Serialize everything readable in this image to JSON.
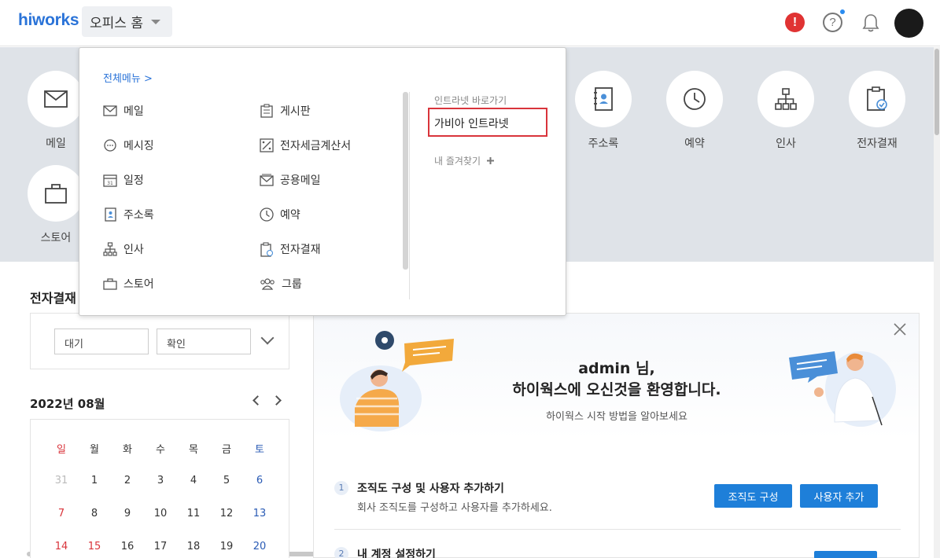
{
  "header": {
    "logo": "hiworks",
    "office_home": "오피스 홈",
    "alert_symbol": "!",
    "help_symbol": "?"
  },
  "apps": [
    {
      "label": "메일",
      "icon": "mail-icon"
    },
    {
      "label": "주소록",
      "icon": "contacts-icon"
    },
    {
      "label": "예약",
      "icon": "clock-icon"
    },
    {
      "label": "인사",
      "icon": "org-icon"
    },
    {
      "label": "전자결재",
      "icon": "approval-icon"
    },
    {
      "label": "스토어",
      "icon": "store-icon"
    }
  ],
  "menu": {
    "all_menu": "전체메뉴 >",
    "left_items": [
      "메일",
      "메시징",
      "일정",
      "주소록",
      "인사",
      "스토어"
    ],
    "right_items": [
      "게시판",
      "전자세금계산서",
      "공용메일",
      "예약",
      "전자결재",
      "그룹"
    ],
    "intranet_title": "인트라넷 바로가기",
    "intranet_link": "가비아 인트라넷",
    "favorites": "내 즐겨찾기"
  },
  "approval": {
    "title": "전자결재",
    "select1": "대기",
    "select2": "확인"
  },
  "calendar": {
    "title": "2022년 08월",
    "weekdays": [
      "일",
      "월",
      "화",
      "수",
      "목",
      "금",
      "토"
    ],
    "rows": [
      [
        "31",
        "1",
        "2",
        "3",
        "4",
        "5",
        "6"
      ],
      [
        "7",
        "8",
        "9",
        "10",
        "11",
        "12",
        "13"
      ],
      [
        "14",
        "15",
        "16",
        "17",
        "18",
        "19",
        "20"
      ]
    ]
  },
  "welcome": {
    "line1": "admin 님,",
    "line2": "하이웍스에 오신것을 환영합니다.",
    "sub": "하이웍스 시작 방법을 알아보세요",
    "step1_num": "1",
    "step1_title": "조직도 구성 및 사용자 추가하기",
    "step1_desc": "회사 조직도를 구성하고 사용자를 추가하세요.",
    "btn_org": "조직도 구성",
    "btn_user": "사용자 추가",
    "step2_num": "2",
    "step2_title": "내 계정 설정하기"
  },
  "colors": {
    "brand": "#2a73d8",
    "alert": "#e03333",
    "button": "#1e7fd9",
    "highlight_border": "#d9343b",
    "sunday": "#d9343b",
    "saturday": "#2a5bb5"
  }
}
